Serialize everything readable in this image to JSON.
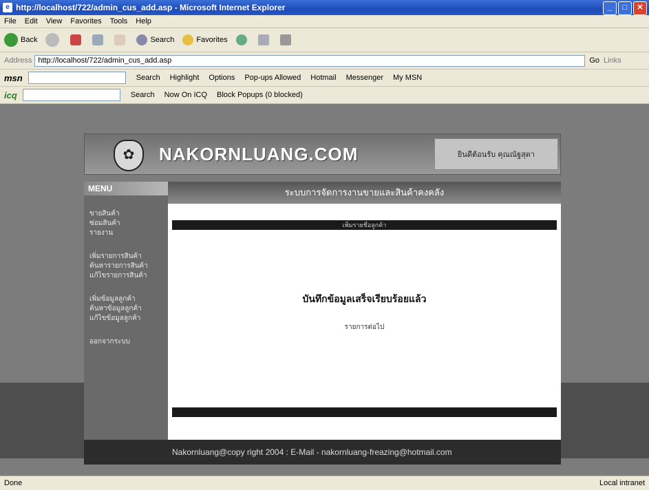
{
  "window": {
    "title": "http://localhost/722/admin_cus_add.asp - Microsoft Internet Explorer"
  },
  "menubar": {
    "items": [
      "File",
      "Edit",
      "View",
      "Favorites",
      "Tools",
      "Help"
    ]
  },
  "toolbar": {
    "back": "Back",
    "search": "Search",
    "favorites": "Favorites"
  },
  "address": {
    "label": "Address",
    "url": "http://localhost/722/admin_cus_add.asp",
    "go": "Go",
    "links": "Links"
  },
  "msnbar": {
    "logo": "msn",
    "search": "Search",
    "highlight": "Highlight",
    "options": "Options",
    "popups": "Pop-ups Allowed",
    "hotmail": "Hotmail",
    "messenger": "Messenger",
    "mymsn": "My MSN"
  },
  "icqbar": {
    "logo": "icq",
    "search": "Search",
    "nowon": "Now On ICQ",
    "block": "Block Popups (0 blocked)"
  },
  "site": {
    "brand": "NAKORNLUANG.COM",
    "welcome": "ยินดีต้อนรับ คุณณัฐสุดา",
    "menu_title": "MENU",
    "menu_group1": [
      "ขายสินค้า",
      "ซ่อมสินค้า",
      "รายงาน"
    ],
    "menu_group2": [
      "เพิ่มรายการสินค้า",
      "ค้นหารายการสินค้า",
      "แก้ไขรายการสินค้า"
    ],
    "menu_group3": [
      "เพิ่มข้อมูลลูกค้า",
      "ค้นหาข้อมูลลูกค้า",
      "แก้ไขข้อมูลลูกค้า"
    ],
    "menu_logout": "ออกจากระบบ",
    "main_header": "ระบบการจัดการงานขายและสินค้าคงคลัง",
    "section_bar": "เพิ่มรายชื่อลูกค้า",
    "done_message": "บันทึกข้อมูลเสร็จเรียบร้อยแล้ว",
    "next_link": "รายการต่อไป",
    "footer": "Nakornluang@copy right 2004 : E-Mail - nakornluang-freazing@hotmail.com"
  },
  "status": {
    "left": "Done",
    "right": "Local intranet"
  }
}
